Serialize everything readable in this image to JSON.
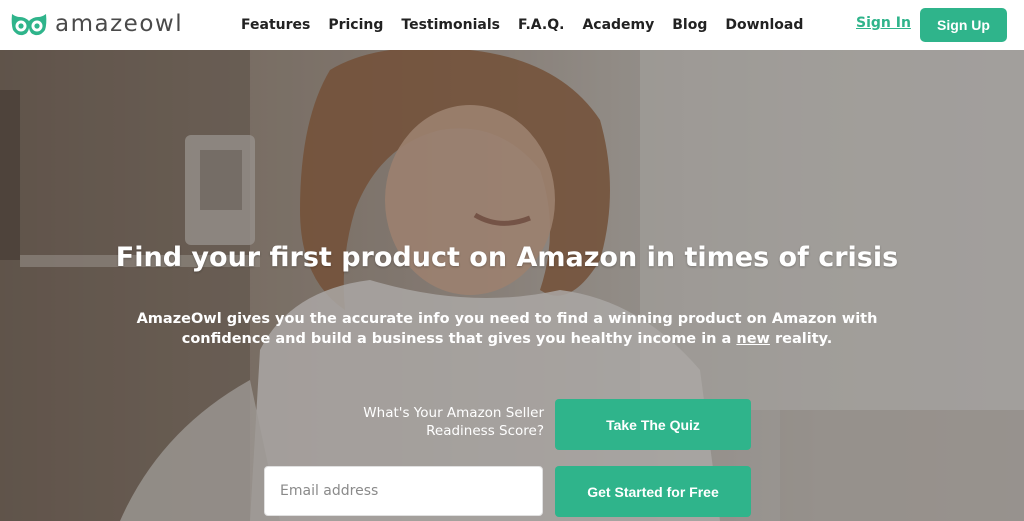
{
  "brand": {
    "logo_text": "amazeowl",
    "accent_color": "#2fb48b"
  },
  "nav": {
    "items": [
      {
        "label": "Features"
      },
      {
        "label": "Pricing"
      },
      {
        "label": "Testimonials"
      },
      {
        "label": "F.A.Q."
      },
      {
        "label": "Academy"
      },
      {
        "label": "Blog"
      },
      {
        "label": "Download"
      }
    ],
    "sign_in": "Sign In",
    "sign_up": "Sign Up"
  },
  "hero": {
    "title": "Find your first product on Amazon in times of crisis",
    "subtitle_before": "AmazeOwl gives you the accurate info you need to find a winning product on Amazon with confidence and build a business that gives you healthy income in a ",
    "subtitle_underlined": "new",
    "subtitle_after": " reality.",
    "quiz_prompt_line1": "What's Your Amazon Seller",
    "quiz_prompt_line2": "Readiness Score?",
    "quiz_button": "Take The Quiz",
    "email_placeholder": "Email address",
    "cta_button": "Get Started for Free"
  }
}
